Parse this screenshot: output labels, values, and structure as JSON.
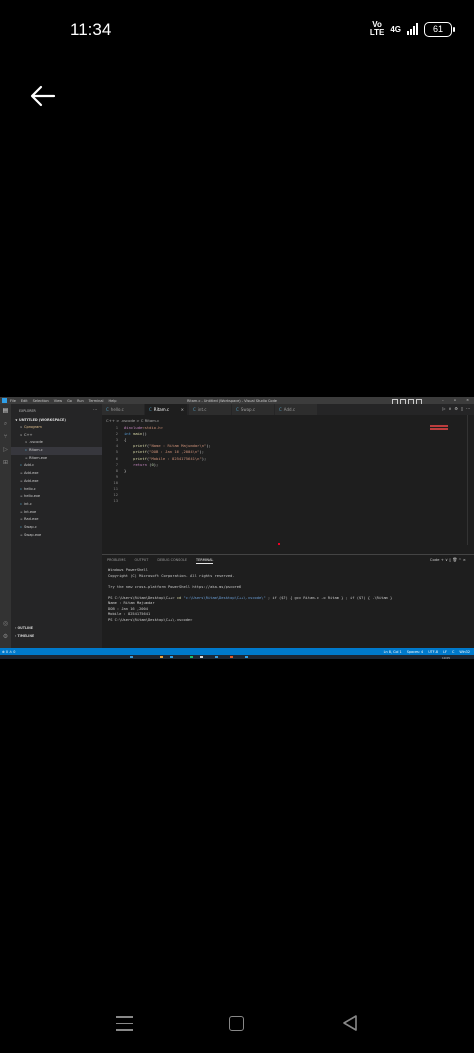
{
  "status": {
    "time": "11:34",
    "volte_top": "Vo",
    "volte_bottom": "LTE",
    "network": "4G",
    "battery": "61"
  },
  "vscode": {
    "menu": [
      "File",
      "Edit",
      "Selection",
      "View",
      "Go",
      "Run",
      "Terminal",
      "Help"
    ],
    "window_title": "Ritam.c - Untitled (Workspace) - Visual Studio Code",
    "explorer_header": "EXPLORER",
    "workspace_label": "UNTITLED (WORKSPACE)",
    "tree": [
      {
        "label": "Cprogram",
        "type": "folder",
        "indent": 1
      },
      {
        "label": "C++",
        "type": "folder",
        "indent": 1
      },
      {
        "label": ".vscode",
        "type": "folder",
        "indent": 2
      },
      {
        "label": "Ritam.c",
        "type": "c",
        "indent": 2,
        "selected": true
      },
      {
        "label": "Ritam.exe",
        "type": "exe",
        "indent": 2
      },
      {
        "label": "Add.c",
        "type": "c",
        "indent": 1
      },
      {
        "label": "Add.exe",
        "type": "exe",
        "indent": 1
      },
      {
        "label": "Add.exe",
        "type": "exe",
        "indent": 1
      },
      {
        "label": "hello.c",
        "type": "c",
        "indent": 1
      },
      {
        "label": "hello.exe",
        "type": "exe",
        "indent": 1
      },
      {
        "label": "int.c",
        "type": "c",
        "indent": 1
      },
      {
        "label": "Int.exe",
        "type": "exe",
        "indent": 1
      },
      {
        "label": "Rad.exe",
        "type": "exe",
        "indent": 1
      },
      {
        "label": "Swap.c",
        "type": "c",
        "indent": 1
      },
      {
        "label": "Swap.exe",
        "type": "exe",
        "indent": 1
      }
    ],
    "outline_label": "OUTLINE",
    "timeline_label": "TIMELINE",
    "tabs": [
      {
        "label": "hello.c",
        "active": false
      },
      {
        "label": "Ritam.c",
        "active": true
      },
      {
        "label": "int.c",
        "active": false
      },
      {
        "label": "Swap.c",
        "active": false
      },
      {
        "label": "Add.c",
        "active": false
      }
    ],
    "breadcrumb": "C++ > .vscode > C Ritam.c",
    "code_lines": [
      {
        "n": "1",
        "text": "#include<stdio.h>"
      },
      {
        "n": "2",
        "text": "int main()"
      },
      {
        "n": "3",
        "text": "{"
      },
      {
        "n": "4",
        "text": "    printf(\"Name : Ritam Majumdar\\n\");"
      },
      {
        "n": "5",
        "text": "    printf(\"DOB : Jan 16 ,2004\\n\");"
      },
      {
        "n": "6",
        "text": "    printf(\"Mobile : 8254175641\\n\");"
      },
      {
        "n": "7",
        "text": "    return (0);"
      },
      {
        "n": "8",
        "text": "}"
      },
      {
        "n": "9",
        "text": ""
      },
      {
        "n": "10",
        "text": ""
      },
      {
        "n": "11",
        "text": ""
      },
      {
        "n": "12",
        "text": ""
      },
      {
        "n": "13",
        "text": ""
      }
    ],
    "panel_tabs": [
      "PROBLEMS",
      "OUTPUT",
      "DEBUG CONSOLE",
      "TERMINAL"
    ],
    "panel_actions": "Code + ∨ ▯ 🗑 ^ ×",
    "terminal_lines": [
      "Windows PowerShell",
      "Copyright (C) Microsoft Corporation. All rights reserved.",
      "",
      "Try the new cross-platform PowerShell https://aka.ms/pscore6",
      "",
      "PS C:\\Users\\Ritam\\Desktop\\C++> cd \"c:\\Users\\Ritam\\Desktop\\C++\\.vscode\\\" ; if ($?) { gcc Ritam.c -o Ritam } ; if ($?) { .\\Ritam }",
      "Name : Ritam Majumdar",
      "DOB : Jan 16 ,2004",
      "Mobile : 8254175641",
      "PS C:\\Users\\Ritam\\Desktop\\C++\\.vscode>"
    ],
    "statusbar_left": "⊗ 0 ⚠ 0",
    "statusbar_right": [
      "Ln 8, Col 1",
      "Spaces: 4",
      "UTF-8",
      "LF",
      "C",
      "Win32"
    ],
    "clock": "10:05"
  },
  "colors": {
    "accent": "#007acc",
    "editor_bg": "#1e1e1e",
    "keyword": "#569cd6",
    "string": "#ce9178",
    "function": "#dcdcaa"
  }
}
